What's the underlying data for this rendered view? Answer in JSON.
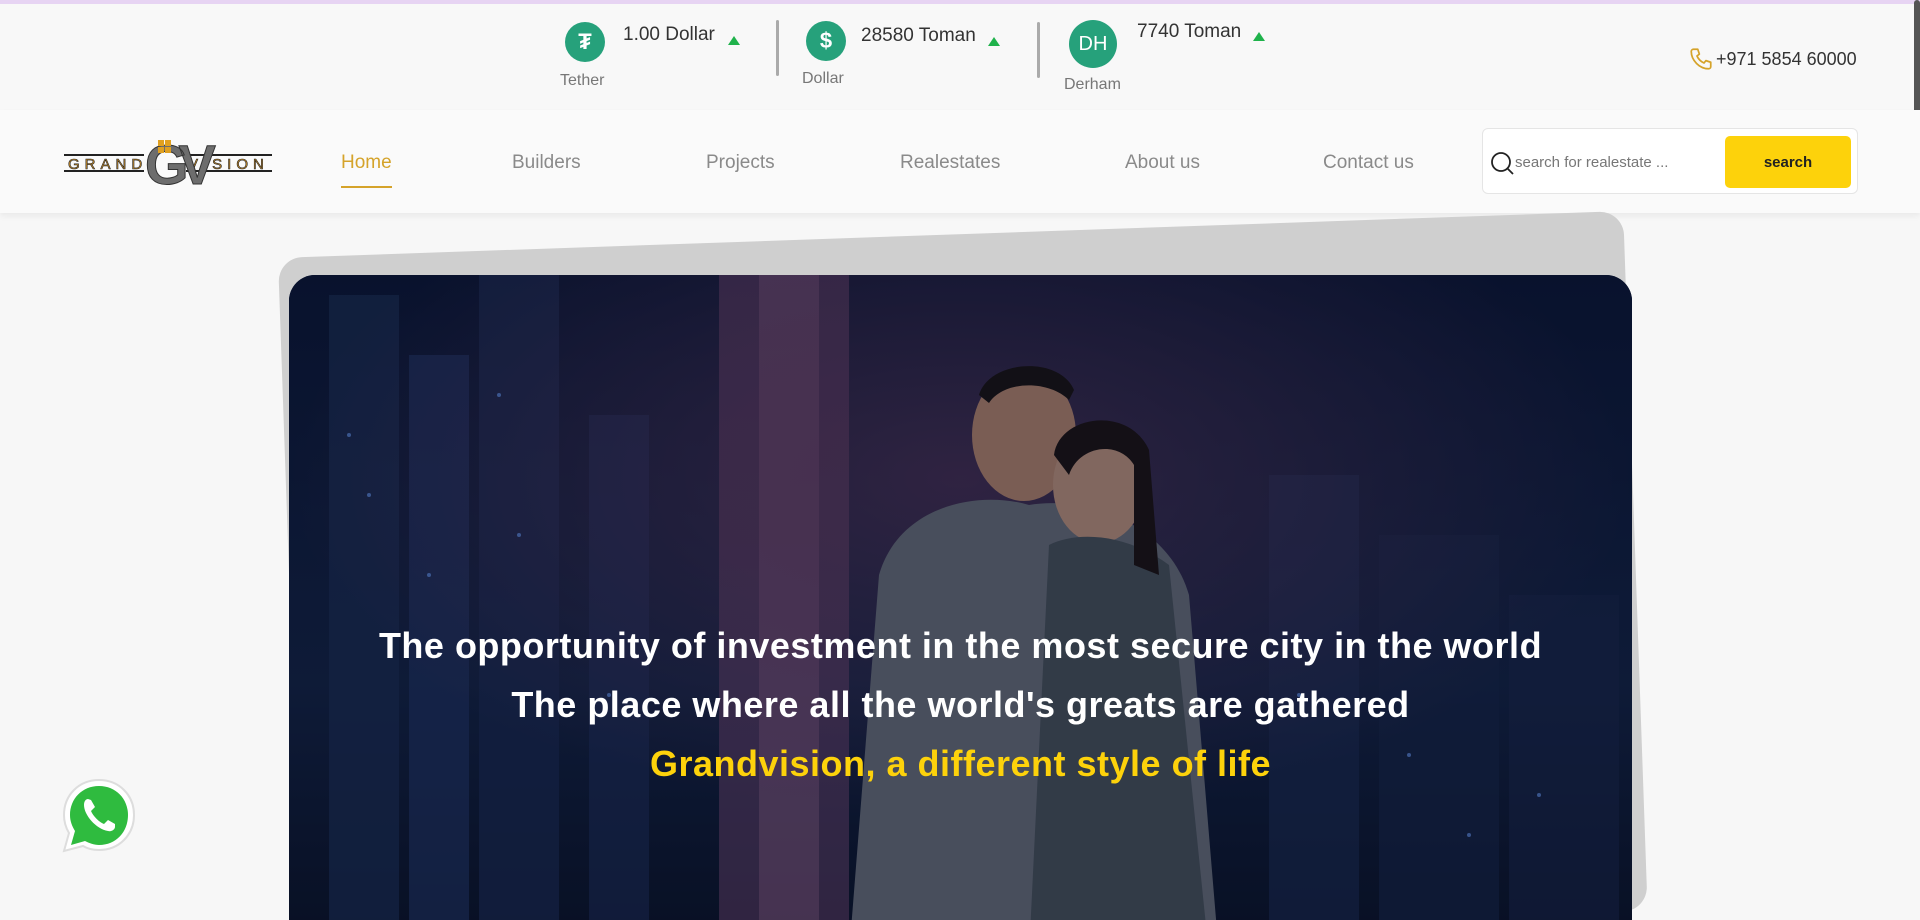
{
  "colors": {
    "accent": "#d5a32a",
    "search_button": "#fdd20b",
    "hero_highlight": "#fdd20b",
    "coin": "#26a17b",
    "up_arrow": "#1fb24b"
  },
  "currencies": [
    {
      "icon": "tether-icon",
      "symbol": "₮",
      "value": "1.00 Dollar",
      "name": "Tether",
      "trend": "up"
    },
    {
      "icon": "dollar-icon",
      "symbol": "$",
      "value": "28580 Toman",
      "name": "Dollar",
      "trend": "up"
    },
    {
      "icon": "derham-icon",
      "symbol": "DH",
      "value": "7740 Toman",
      "name": "Derham",
      "trend": "up"
    }
  ],
  "contact": {
    "phone": "+971 5854 60000",
    "icon": "phone-icon"
  },
  "logo": {
    "left": "GRAND",
    "mark": "GV",
    "right": "VISION"
  },
  "nav": {
    "items": [
      {
        "label": "Home",
        "active": true
      },
      {
        "label": "Builders"
      },
      {
        "label": "Projects"
      },
      {
        "label": "Realestates"
      },
      {
        "label": "About us"
      },
      {
        "label": "Contact us"
      }
    ]
  },
  "search": {
    "placeholder": "search for realestate ...",
    "button_label": "search",
    "icon": "search-icon"
  },
  "hero": {
    "line1": "The opportunity of investment in the most secure city in the world",
    "line2": "The place where all the world's greats are gathered",
    "line3": "Grandvision, a different style of life"
  },
  "floating": {
    "whatsapp_icon": "whatsapp-icon"
  }
}
